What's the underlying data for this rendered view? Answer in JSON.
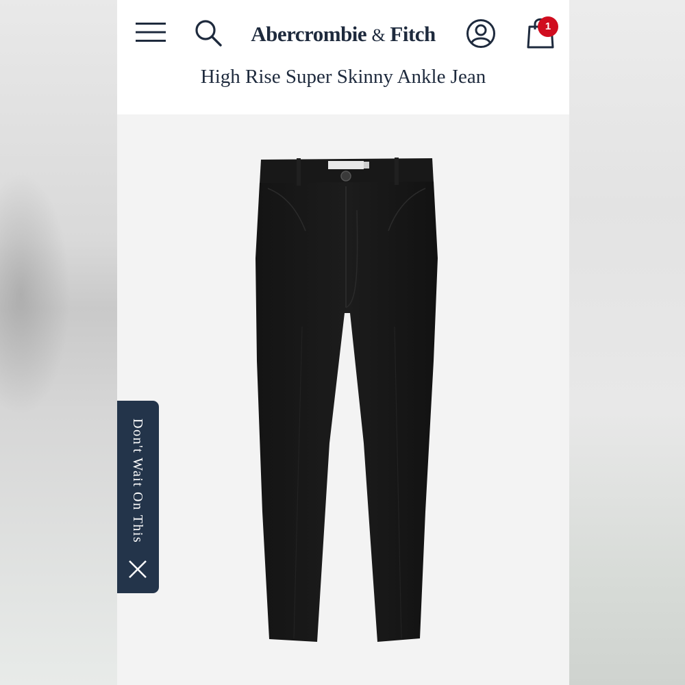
{
  "header": {
    "brand_main": "Abercrombie",
    "brand_amp": "&",
    "brand_end": "Fitch",
    "menu_icon": "hamburger-menu-icon",
    "search_icon": "search-icon",
    "account_icon": "account-icon",
    "bag_icon": "shopping-bag-icon",
    "cart_count": "1"
  },
  "product": {
    "title": "High Rise Super Skinny Ankle Jean",
    "image_alt": "black high rise super skinny jeans"
  },
  "promo_tab": {
    "label": "Don't Wait On This",
    "close_icon": "close-icon"
  },
  "colors": {
    "brand_navy": "#1e2a3d",
    "promo_bg": "#23344a",
    "badge_red": "#d00d1f"
  }
}
